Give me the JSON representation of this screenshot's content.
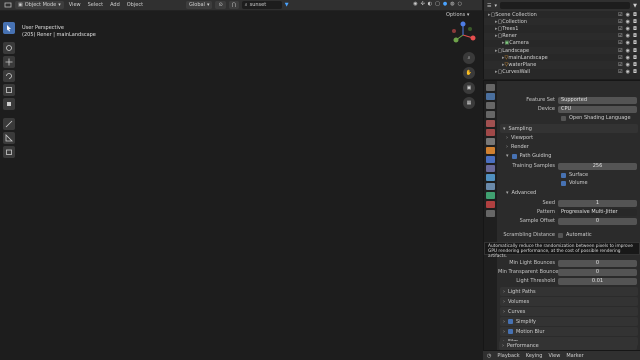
{
  "header": {
    "mode": "Object Mode",
    "menus": [
      "View",
      "Select",
      "Add",
      "Object"
    ],
    "orientation": "Global",
    "search_value": "sunset",
    "options_label": "Options"
  },
  "viewport": {
    "view_name": "User Perspective",
    "collection_info": "(205) Rener | mainLandscape"
  },
  "outliner": {
    "rows": [
      {
        "label": "Scene Collection",
        "indent": 0,
        "icon": "collection-icon"
      },
      {
        "label": "Collection",
        "indent": 1,
        "icon": "collection-icon"
      },
      {
        "label": "Trees1",
        "indent": 1,
        "icon": "collection-icon"
      },
      {
        "label": "Rener",
        "indent": 1,
        "icon": "collection-icon"
      },
      {
        "label": "Camera",
        "indent": 2,
        "icon": "camera-icon"
      },
      {
        "label": "Landscape",
        "indent": 1,
        "icon": "collection-icon"
      },
      {
        "label": "mainLandscape",
        "indent": 2,
        "icon": "mesh-icon"
      },
      {
        "label": "waterPlane",
        "indent": 2,
        "icon": "mesh-icon"
      },
      {
        "label": "CurvesWall",
        "indent": 1,
        "icon": "collection-icon"
      }
    ]
  },
  "properties": {
    "feature_set_label": "Feature Set",
    "feature_set_value": "Supported",
    "device_label": "Device",
    "device_value": "CPU",
    "osl_label": "Open Shading Language",
    "sampling_label": "Sampling",
    "viewport_label": "Viewport",
    "render_label": "Render",
    "path_guiding_label": "Path Guiding",
    "training_samples_label": "Training Samples",
    "training_samples_value": "256",
    "surface_label": "Surface",
    "volume_label": "Volume",
    "advanced_label": "Advanced",
    "seed_label": "Seed",
    "seed_value": "1",
    "pattern_label": "Pattern",
    "pattern_value": "Progressive Multi-Jitter",
    "sample_offset_label": "Sample Offset",
    "sample_offset_value": "0",
    "scrambling_label": "Scrambling Distance",
    "scrambling_value": "Automatic",
    "min_light_bounces_label": "Min Light Bounces",
    "min_light_bounces_value": "0",
    "min_transparent_label": "Min Transparent Bounces",
    "min_transparent_value": "0",
    "light_threshold_label": "Light Threshold",
    "light_threshold_value": "0.01",
    "light_paths_label": "Light Paths",
    "volumes_label": "Volumes",
    "curves_label": "Curves",
    "simplify_label": "Simplify",
    "motion_blur_label": "Motion Blur",
    "film_label": "Film",
    "performance_label": "Performance"
  },
  "tooltip": {
    "text": "Automatically reduce the randomization between pixels to improve GPU rendering performance, at the cost of possible rendering artifacts."
  },
  "timeline": {
    "items": [
      "Playback",
      "Keying",
      "View",
      "Marker"
    ]
  },
  "colors": {
    "accent": "#4772b3",
    "panel": "#2b2b2b",
    "header": "#303030"
  }
}
